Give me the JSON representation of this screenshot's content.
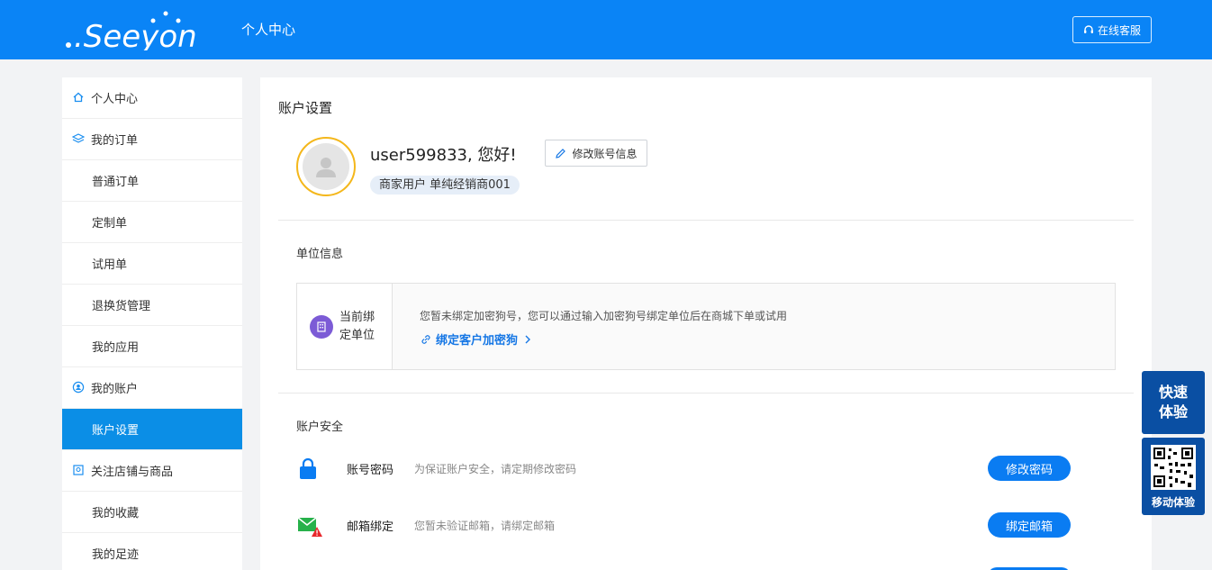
{
  "header": {
    "logo_text": ".Seeyon",
    "title": "个人中心",
    "service_label": "在线客服"
  },
  "sidebar": {
    "items": [
      {
        "label": "个人中心",
        "icon": "home-icon"
      },
      {
        "label": "我的订单",
        "icon": "layers-icon"
      },
      {
        "label": "普通订单"
      },
      {
        "label": "定制单"
      },
      {
        "label": "试用单"
      },
      {
        "label": "退换货管理"
      },
      {
        "label": "我的应用"
      },
      {
        "label": "我的账户",
        "icon": "user-circle-icon"
      },
      {
        "label": "账户设置",
        "active": true
      },
      {
        "label": "关注店铺与商品",
        "icon": "store-icon"
      },
      {
        "label": "我的收藏"
      },
      {
        "label": "我的足迹"
      }
    ]
  },
  "main": {
    "title": "账户设置",
    "greeting": "user599833, 您好!",
    "edit_label": "修改账号信息",
    "user_tag": "商家用户 单纯经销商001",
    "org": {
      "section_title": "单位信息",
      "label": "当前绑定单位",
      "desc": "您暂未绑定加密狗号，您可以通过输入加密狗号绑定单位后在商城下单或试用",
      "link": "绑定客户加密狗"
    },
    "security": {
      "section_title": "账户安全",
      "rows": [
        {
          "name": "账号密码",
          "desc": "为保证账户安全，请定期修改密码",
          "button": "修改密码",
          "icon": "lock-icon"
        },
        {
          "name": "邮箱绑定",
          "desc": "您暂未验证邮箱，请绑定邮箱",
          "button": "绑定邮箱",
          "icon": "mail-warning-icon"
        }
      ]
    }
  },
  "widgets": {
    "quick_label": "快速体验",
    "mobile_label": "移动体验"
  },
  "colors": {
    "header_bg": "#0a84f6",
    "active_nav": "#0b8ee6",
    "primary_button": "#0a7cf2",
    "avatar_ring": "#f4b71b",
    "widget_bg": "#0a4fa3"
  }
}
